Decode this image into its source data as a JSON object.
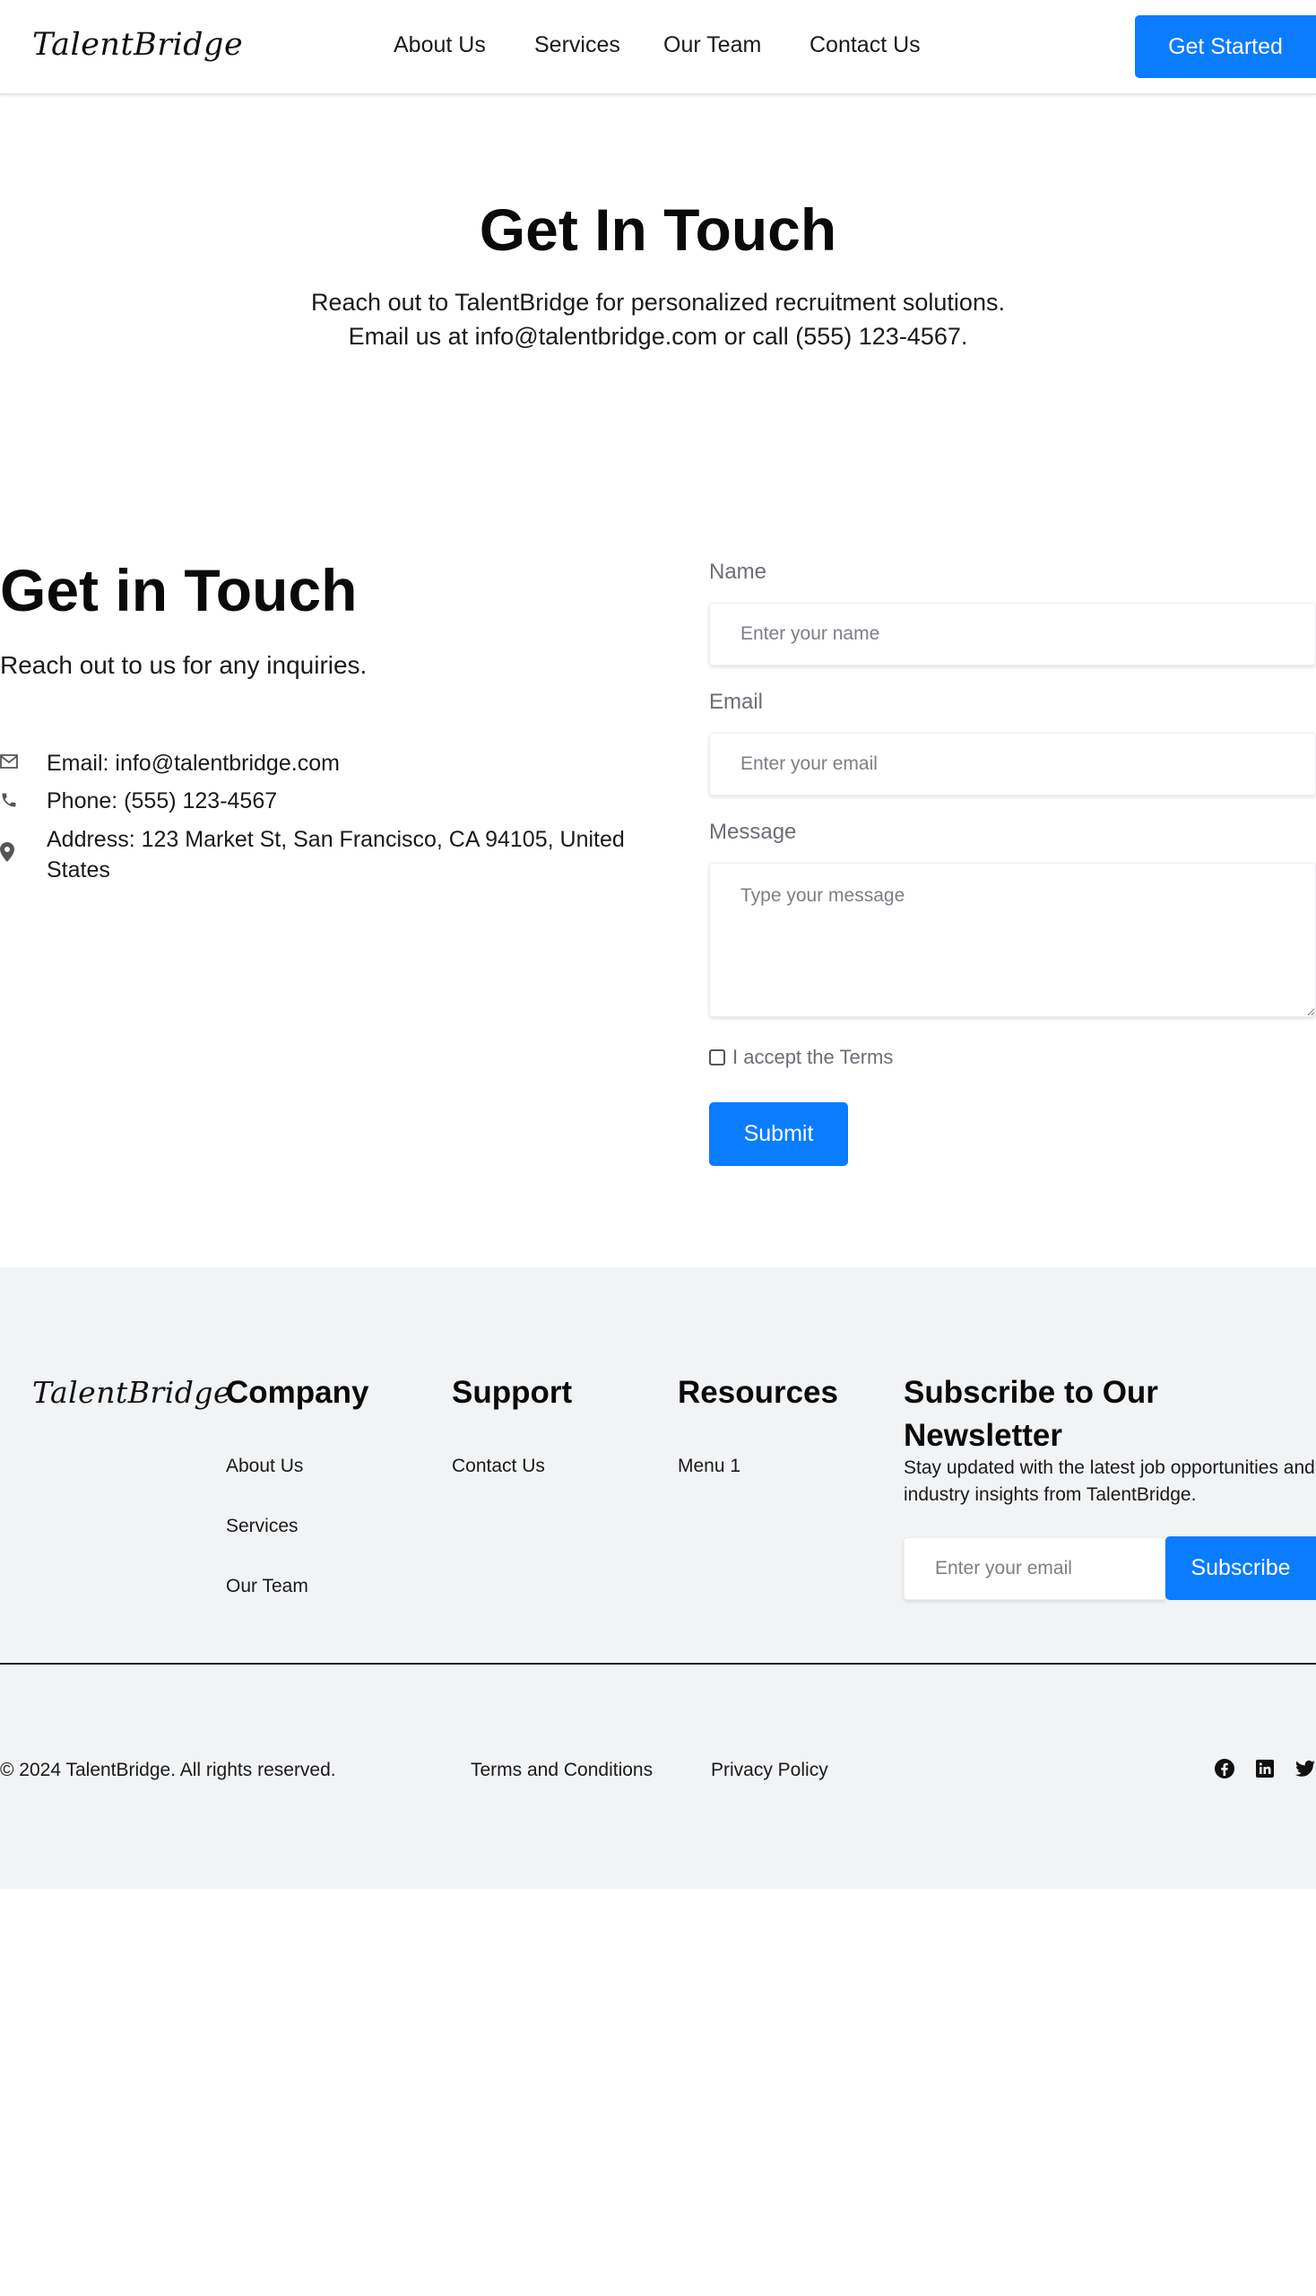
{
  "header": {
    "logo": "TalentBridge",
    "nav": [
      "About Us",
      "Services",
      "Our Team",
      "Contact Us"
    ],
    "cta": "Get Started"
  },
  "hero": {
    "title": "Get In Touch",
    "line1": "Reach out to TalentBridge for personalized recruitment solutions.",
    "line2": "Email us at info@talentbridge.com or call (555) 123-4567."
  },
  "contact": {
    "title": "Get in Touch",
    "subtitle": "Reach out to us for any inquiries.",
    "email": "Email: info@talentbridge.com",
    "phone": "Phone: (555) 123-4567",
    "address": "Address: 123 Market St, San Francisco, CA 94105, United States",
    "icons": [
      "envelope-icon",
      "phone-icon",
      "map-pin-icon"
    ]
  },
  "form": {
    "name_label": "Name",
    "name_placeholder": "Enter your name",
    "email_label": "Email",
    "email_placeholder": "Enter your email",
    "message_label": "Message",
    "message_placeholder": "Type your message",
    "terms_label": "I accept the Terms",
    "submit": "Submit"
  },
  "footer": {
    "logo": "TalentBridge",
    "company": {
      "title": "Company",
      "links": [
        "About Us",
        "Services",
        "Our Team"
      ]
    },
    "support": {
      "title": "Support",
      "links": [
        "Contact Us"
      ]
    },
    "resources": {
      "title": "Resources",
      "links": [
        "Menu 1"
      ]
    },
    "newsletter": {
      "title": "Subscribe to Our Newsletter",
      "text": "Stay updated with the latest job opportunities and industry insights from TalentBridge.",
      "placeholder": "Enter your email",
      "button": "Subscribe"
    },
    "copyright": "© 2024 TalentBridge. All rights reserved.",
    "legal": [
      "Terms and Conditions",
      "Privacy Policy"
    ],
    "social": [
      "facebook-icon",
      "linkedin-icon",
      "twitter-icon"
    ]
  },
  "colors": {
    "accent": "#0a7cff",
    "footer_bg": "#f2f3f5",
    "muted": "#6b6f76"
  }
}
